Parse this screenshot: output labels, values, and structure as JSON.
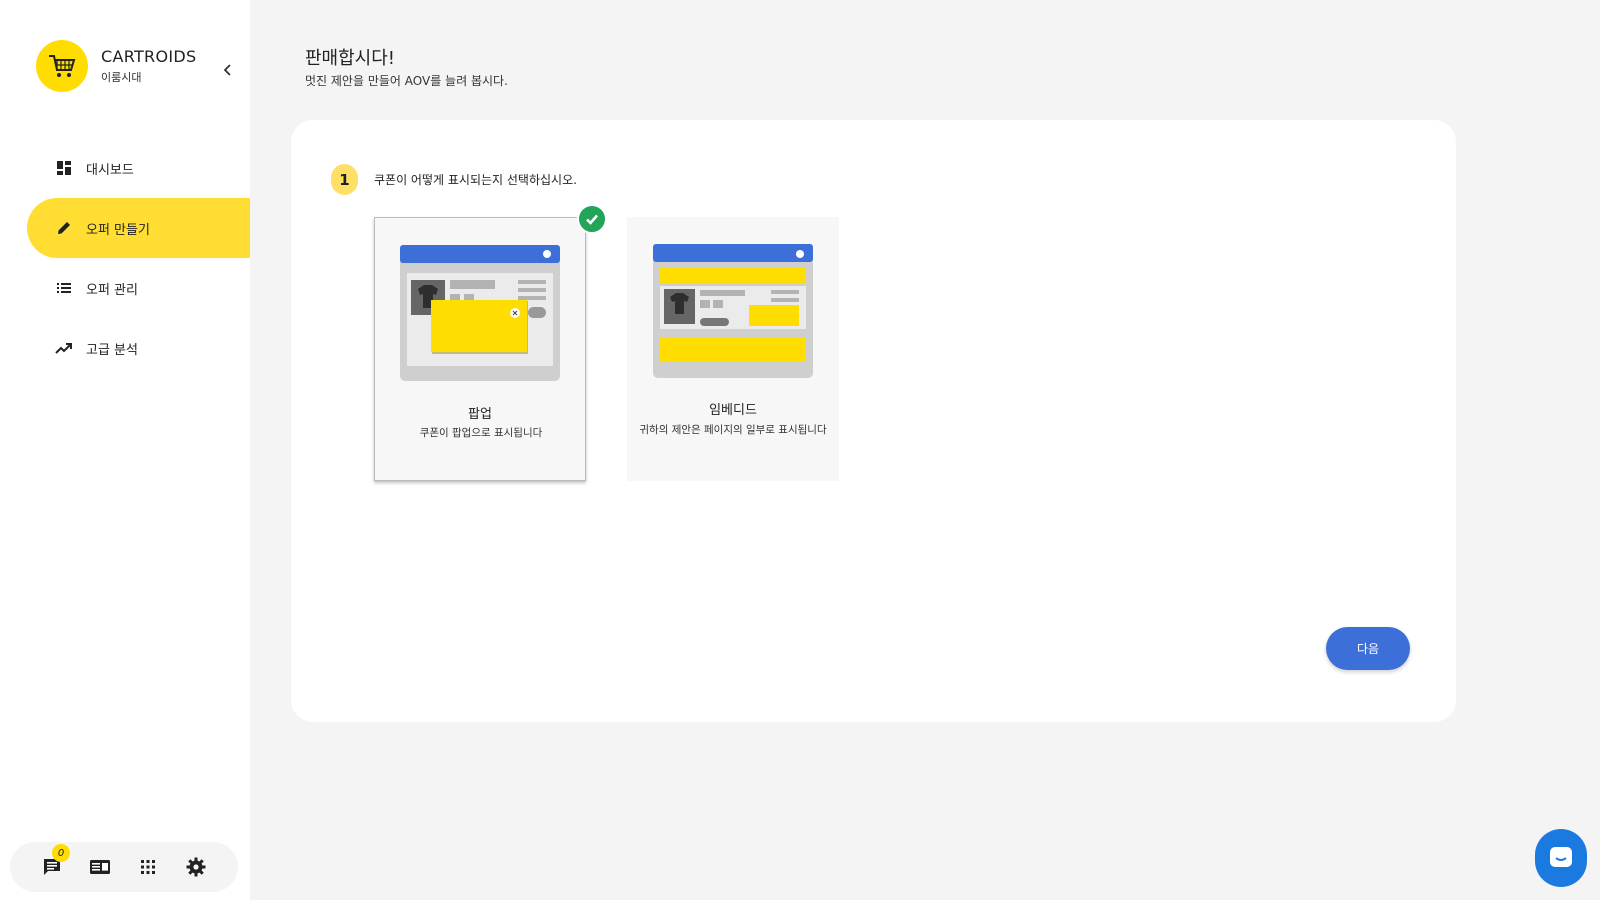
{
  "brand": {
    "name": "CARTROIDS",
    "subtitle": "이룸시대"
  },
  "nav": [
    {
      "label": "대시보드",
      "icon": "dashboard-icon"
    },
    {
      "label": "오퍼 만들기",
      "icon": "pencil-icon",
      "active": true
    },
    {
      "label": "오퍼 관리",
      "icon": "list-icon"
    },
    {
      "label": "고급 분석",
      "icon": "trending-up-icon"
    }
  ],
  "footer": {
    "chat_badge": "0"
  },
  "header": {
    "title": "판매합시다!",
    "subtitle": "멋진 제안을 만들어 AOV를 늘려 봅시다."
  },
  "step": {
    "number": "1",
    "text": "쿠폰이 어떻게 표시되는지 선택하십시오."
  },
  "options": [
    {
      "title": "팝업",
      "description": "쿠폰이 팝업으로 표시됩니다",
      "selected": true
    },
    {
      "title": "임베디드",
      "description": "귀하의 제안은 페이지의 일부로 표시됩니다",
      "selected": false
    }
  ],
  "actions": {
    "next_label": "다음"
  },
  "colors": {
    "accent": "#ffdd33",
    "primary": "#3d6fd9",
    "success": "#23a559"
  }
}
